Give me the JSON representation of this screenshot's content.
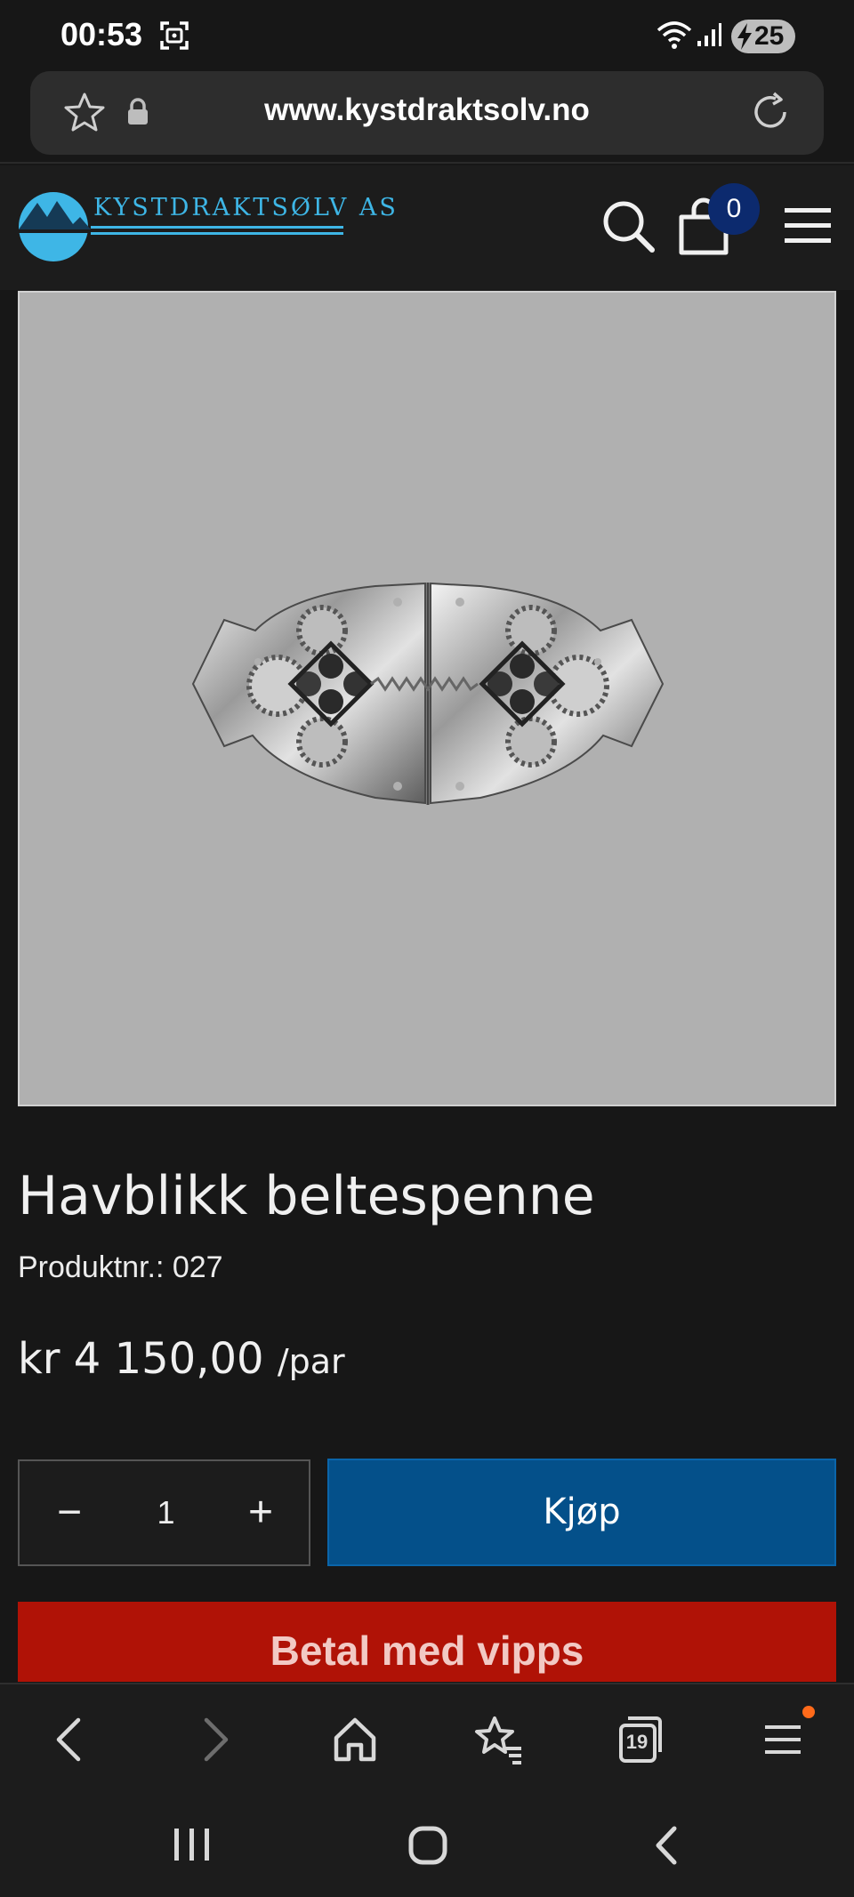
{
  "status_bar": {
    "time": "00:53",
    "battery_level": "25"
  },
  "browser": {
    "url": "www.kystdraktsolv.no",
    "tab_count": "19"
  },
  "site": {
    "logo_text": "KYSTDRAKTSØLV AS",
    "cart_count": "0",
    "brand_color": "#3eb6e6"
  },
  "product": {
    "title": "Havblikk beltespenne",
    "number_label": "Produktnr.: 027",
    "price": "kr 4 150,00",
    "price_unit": "/par",
    "quantity": "1"
  },
  "actions": {
    "minus": "−",
    "plus": "+",
    "buy_label": "Kjøp",
    "vipps_label": "Betal med vipps"
  },
  "icons": [
    "screenshot-icon",
    "wifi-icon",
    "signal-icon",
    "star-icon",
    "lock-icon",
    "reload-icon",
    "search-icon",
    "cart-icon",
    "menu-icon",
    "back-icon",
    "forward-icon",
    "home-icon",
    "bookmarks-icon",
    "tabs-icon",
    "recent-apps-icon",
    "home-circle-icon"
  ]
}
